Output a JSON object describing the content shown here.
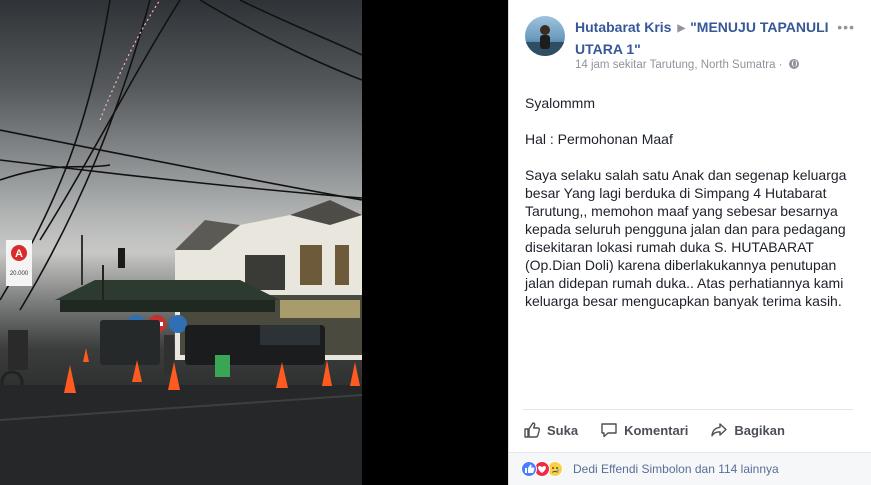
{
  "post": {
    "author": "Hutabarat Kris",
    "group": "\"MENUJU TAPANULI UTARA 1\"",
    "meta": "14 jam sekitar Tarutung, North Sumatra ·",
    "paragraphs": [
      "Syalommm",
      "Hal : Permohonan Maaf",
      "Saya selaku salah satu Anak dan segenap keluarga besar Yang lagi berduka di Simpang 4 Hutabarat Tarutung,, memohon maaf yang sebesar besarnya kepada seluruh pengguna jalan dan para pedagang disekitaran lokasi rumah duka S. HUTABARAT (Op.Dian Doli) karena diberlakukannya penutupan jalan didepan rumah duka.. Atas perhatiannya kami keluarga besar mengucapkan banyak terima kasih."
    ],
    "more_glyph": "•••",
    "arrow_glyph": "▶"
  },
  "actions": {
    "like": "Suka",
    "comment": "Komentari",
    "share": "Bagikan"
  },
  "reactions": {
    "summary": "Dedi Effendi Simbolon dan 114 lainnya",
    "icons": [
      "like-icon",
      "love-icon",
      "sad-icon"
    ]
  },
  "photo": {
    "sign_text": "20.000",
    "sign_letter": "A"
  },
  "colors": {
    "link": "#365899",
    "muted": "#90949c",
    "text": "#1d2129",
    "like_blue": "#4a7cff"
  }
}
